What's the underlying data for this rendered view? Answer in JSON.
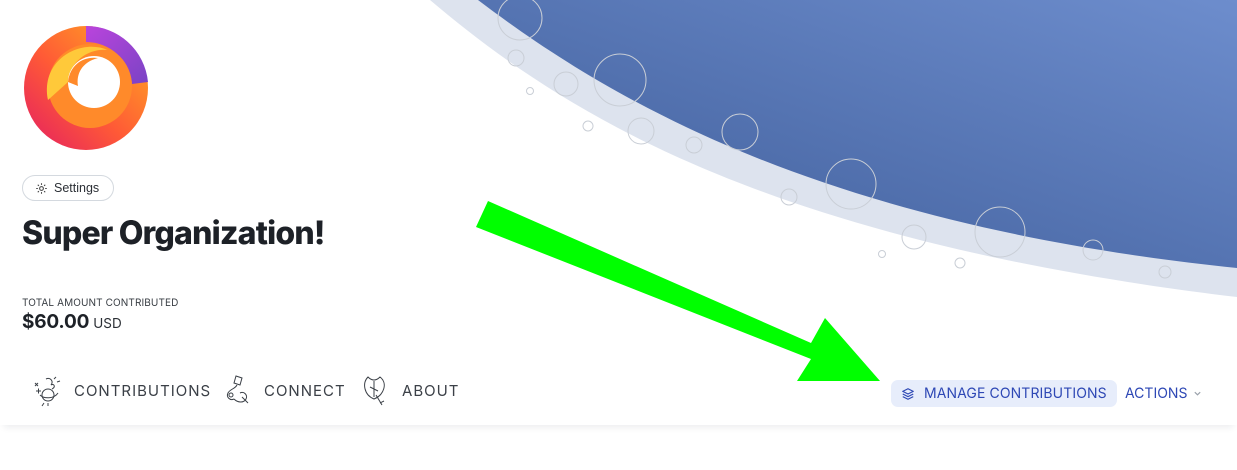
{
  "organization": {
    "name": "Super Organization!",
    "settings_label": "Settings"
  },
  "totals": {
    "label": "TOTAL AMOUNT CONTRIBUTED",
    "amount": "$60.00",
    "currency": "USD"
  },
  "nav": {
    "items": [
      {
        "label": "CONTRIBUTIONS",
        "icon": "contributions-illustration-icon"
      },
      {
        "label": "CONNECT",
        "icon": "connect-illustration-icon"
      },
      {
        "label": "ABOUT",
        "icon": "about-illustration-icon"
      }
    ],
    "manage_label": "MANAGE CONTRIBUTIONS",
    "actions_label": "ACTIONS"
  },
  "colors": {
    "accent": "#2e48b5",
    "manage_bg": "#e7edfb",
    "hero_dark": "#3d5b97",
    "hero_light": "#6d8dcd",
    "annotation_arrow": "#00ff00"
  }
}
